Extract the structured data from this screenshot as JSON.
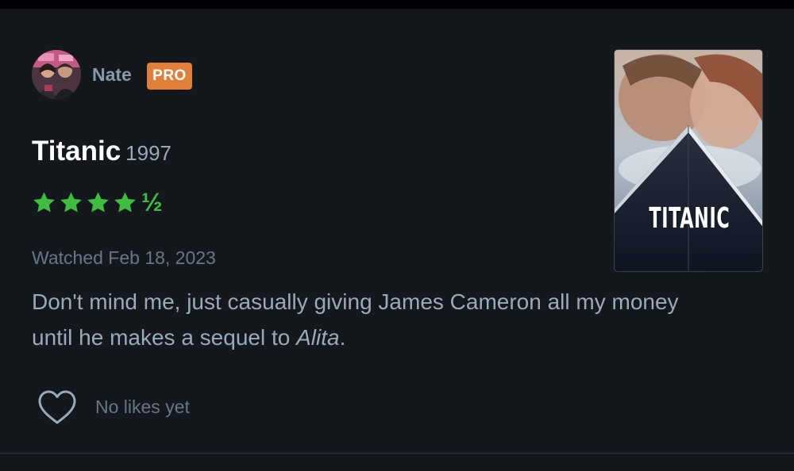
{
  "reviewer": {
    "name": "Nate",
    "badge": "PRO",
    "avatar": "reviewer-avatar-photo"
  },
  "film": {
    "title": "Titanic",
    "year": "1997",
    "poster_title": "TITANIC"
  },
  "rating": {
    "stars": 4.5,
    "half_glyph": "½",
    "star_color": "#40bc40"
  },
  "watched": "Watched Feb 18, 2023",
  "review": {
    "text_before": "Don't mind me, just casually giving James Cameron all my money until he makes a sequel to ",
    "text_italic": "Alita",
    "text_after": "."
  },
  "likes": {
    "label": "No likes yet",
    "icon": "heart-outline-icon"
  },
  "colors": {
    "background": "#14181c",
    "pro_badge": "#e17e3a",
    "title": "#ffffff",
    "muted_text": "#667788",
    "body_text": "#99aabb"
  }
}
